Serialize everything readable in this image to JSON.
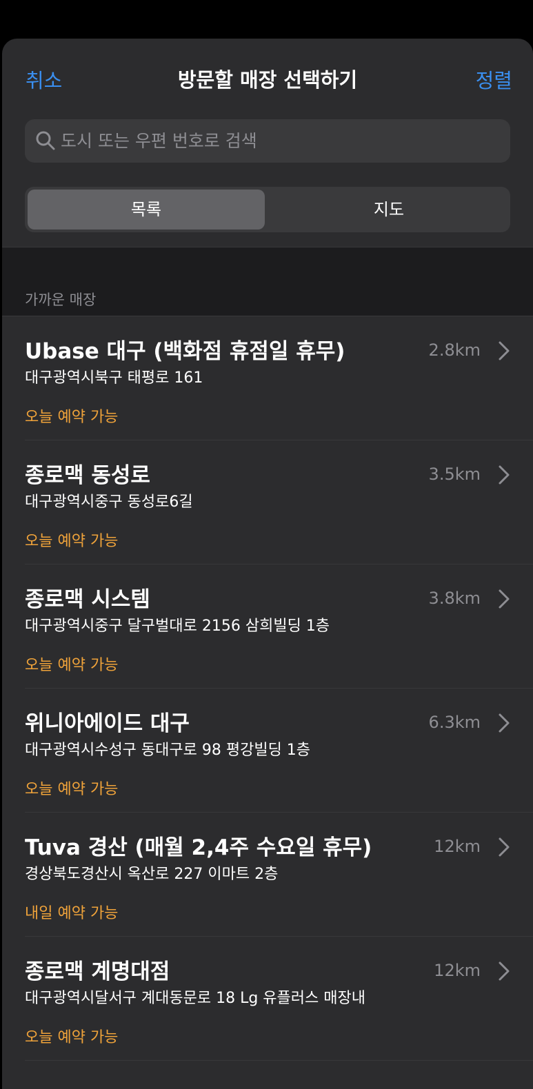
{
  "nav": {
    "cancel_label": "취소",
    "title": "방문할 매장 선택하기",
    "sort_label": "정렬"
  },
  "search": {
    "placeholder": "도시 또는 우편 번호로 검색",
    "value": ""
  },
  "segments": {
    "list_label": "목록",
    "map_label": "지도",
    "selected": "목록"
  },
  "section": {
    "header": "가까운 매장"
  },
  "stores": [
    {
      "name": "Ubase 대구 (백화점 휴점일 휴무)",
      "address": "대구광역시북구 태평로 161",
      "availability": "오늘 예약 가능",
      "distance": "2.8km"
    },
    {
      "name": "종로맥 동성로",
      "address": "대구광역시중구 동성로6길",
      "availability": "오늘 예약 가능",
      "distance": "3.5km"
    },
    {
      "name": "종로맥 시스템",
      "address": "대구광역시중구 달구벌대로 2156 삼희빌딩 1층",
      "availability": "오늘 예약 가능",
      "distance": "3.8km"
    },
    {
      "name": "위니아에이드 대구",
      "address": "대구광역시수성구 동대구로 98 평강빌딩 1층",
      "availability": "오늘 예약 가능",
      "distance": "6.3km"
    },
    {
      "name": "Tuva 경산 (매월 2,4주 수요일 휴무)",
      "address": "경상북도경산시 옥산로 227 이마트 2층",
      "availability": "내일 예약 가능",
      "distance": "12km"
    },
    {
      "name": "종로맥 계명대점",
      "address": "대구광역시달서구 계대동문로 18 Lg 유플러스 매장내",
      "availability": "오늘 예약 가능",
      "distance": "12km"
    }
  ],
  "colors": {
    "accent": "#3a8ff0",
    "availability": "#f0a33a",
    "sheet_background": "#2c2c2e",
    "secondary_text": "#8e8e93"
  }
}
